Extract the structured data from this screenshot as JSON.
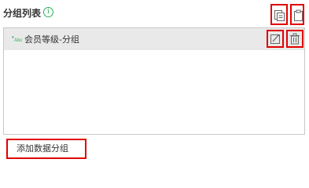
{
  "header": {
    "title": "分组列表",
    "info_icon_glyph": "i",
    "actions": [
      {
        "name": "copy-icon"
      },
      {
        "name": "paste-icon"
      }
    ]
  },
  "list": {
    "items": [
      {
        "type_icon": "abc-text-field-icon",
        "type_icon_text": "Abc",
        "label": "会员等级-分组",
        "actions": [
          "edit-icon",
          "delete-icon"
        ]
      }
    ]
  },
  "footer": {
    "add_button_label": "添加数据分组"
  },
  "colors": {
    "accent_green": "#2eae5a",
    "highlight_red": "#e00000",
    "row_background": "#e9e9e9"
  }
}
